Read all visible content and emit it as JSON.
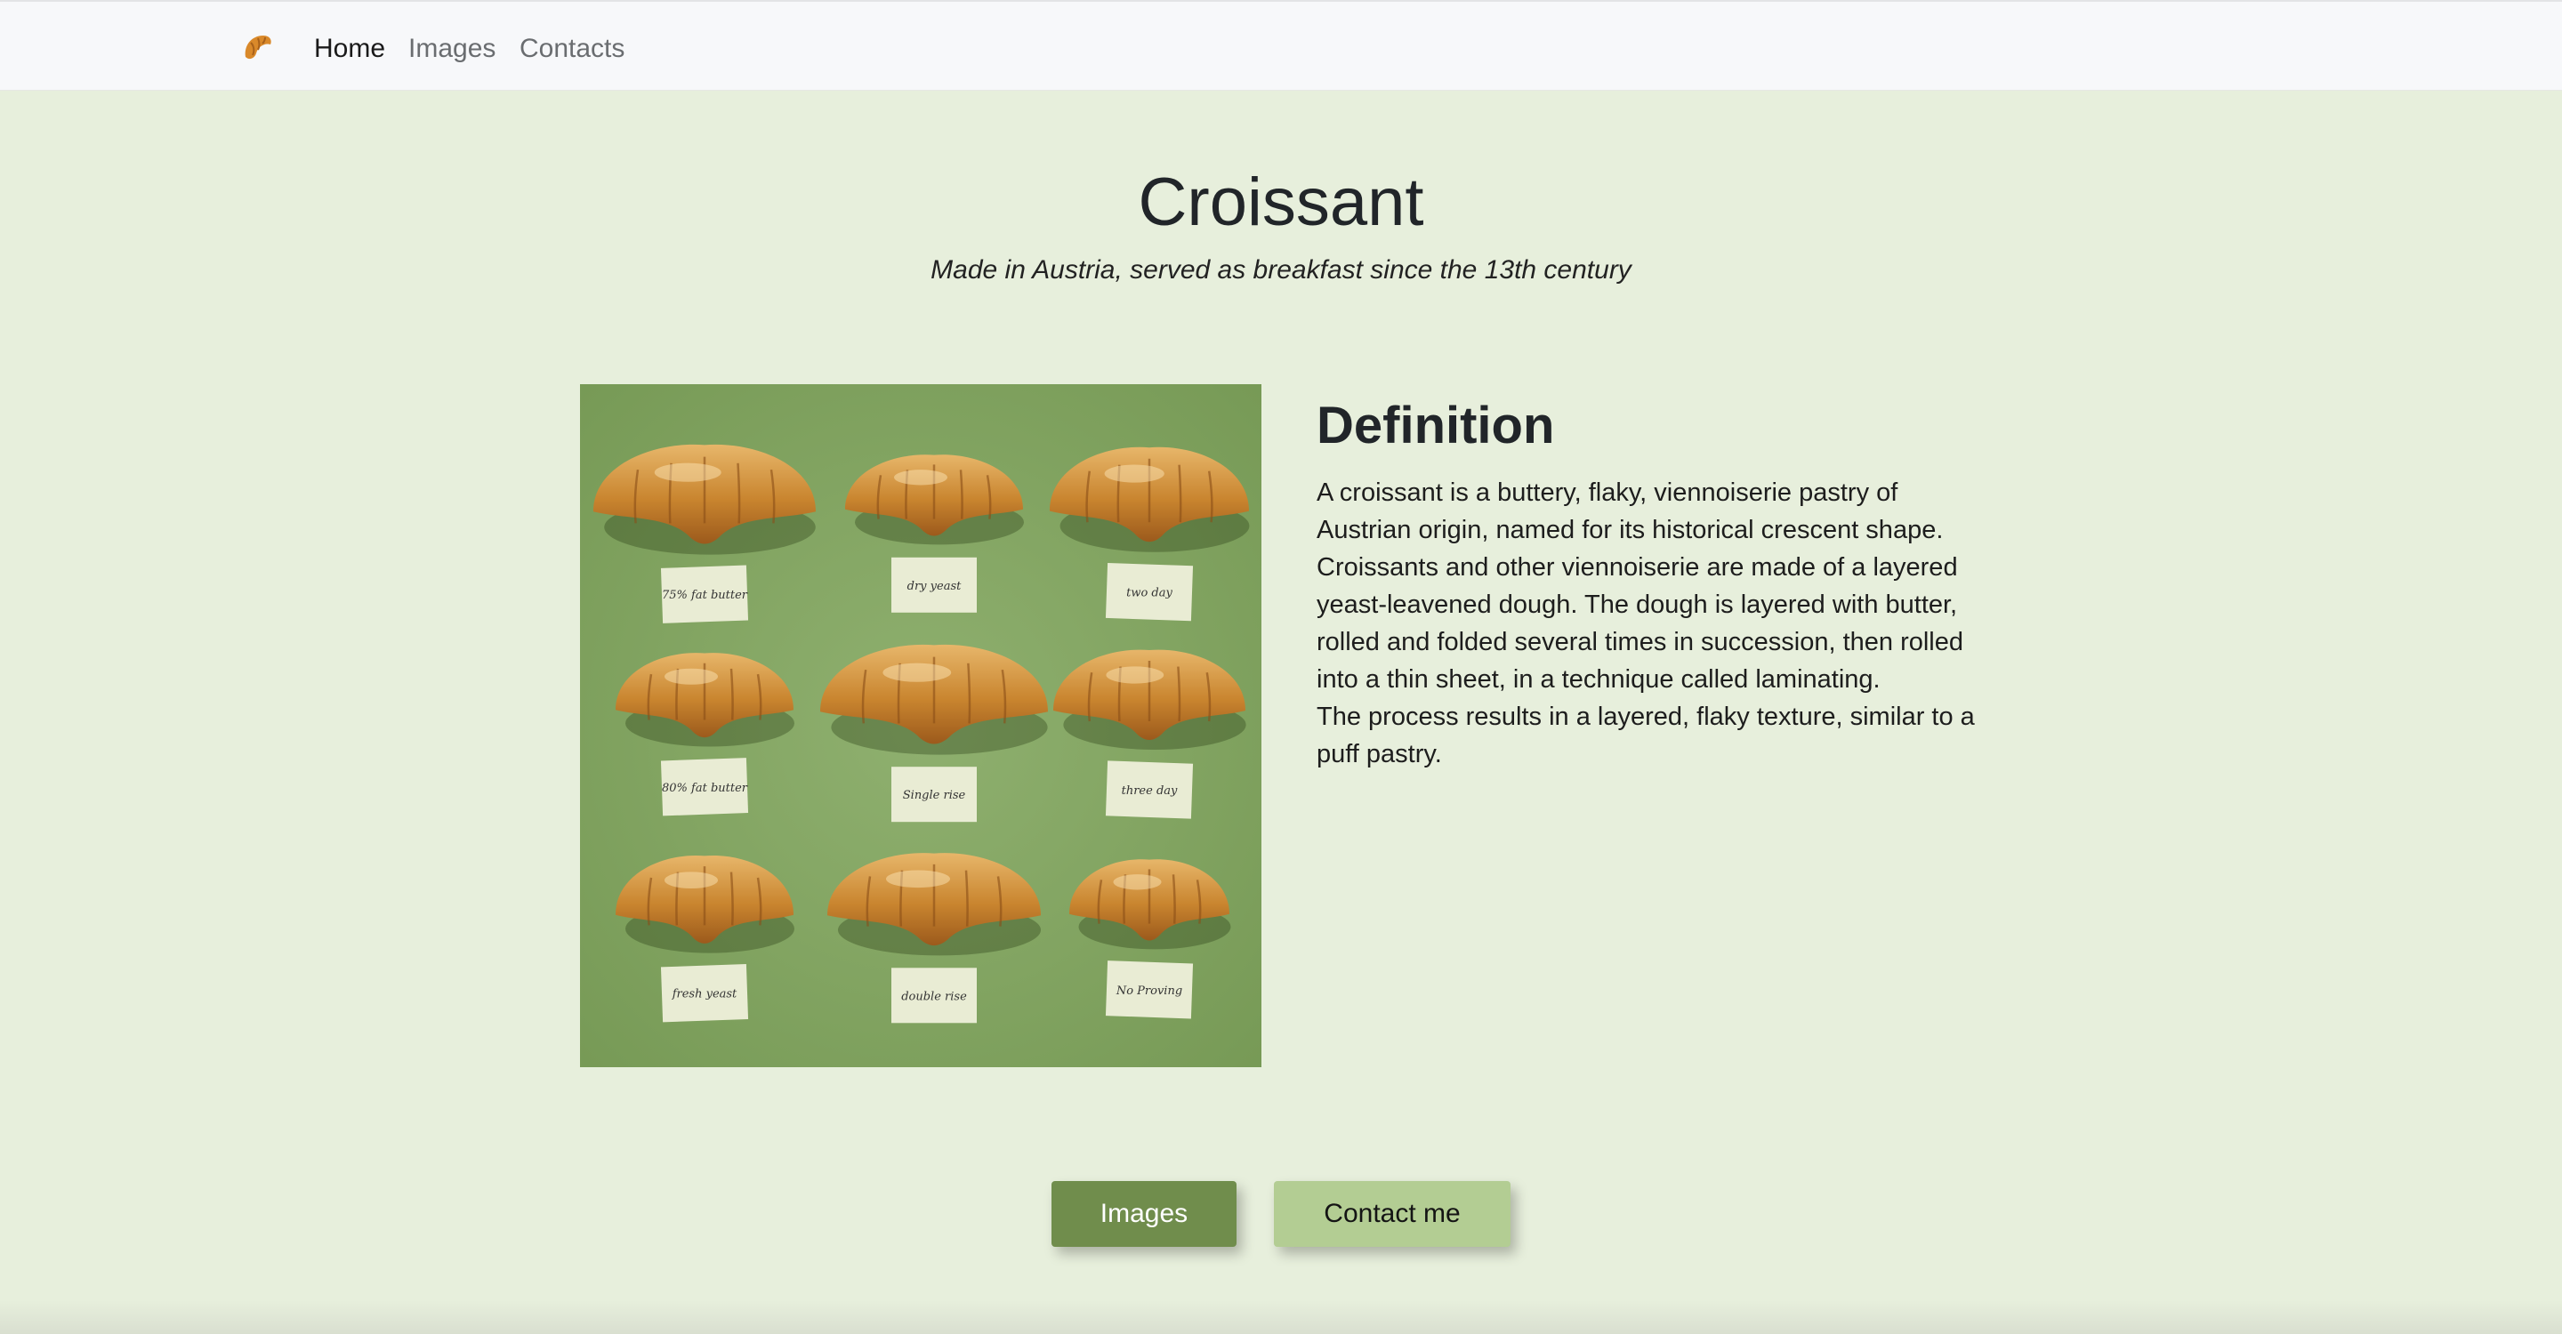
{
  "navbar": {
    "brand_icon": "croissant-icon",
    "links": [
      {
        "label": "Home",
        "active": true
      },
      {
        "label": "Images",
        "active": false
      },
      {
        "label": "Contacts",
        "active": false
      }
    ]
  },
  "hero": {
    "title": "Croissant",
    "subtitle": "Made in Austria, served as breakfast since the 13th century"
  },
  "photo": {
    "labels": [
      "75% fat butter",
      "dry yeast",
      "two day",
      "80% fat butter",
      "Single rise",
      "three day",
      "fresh yeast",
      "double rise",
      "No Proving"
    ]
  },
  "definition": {
    "title": "Definition",
    "paragraph1": "A croissant is a buttery, flaky, viennoiserie pastry of Austrian origin, named for its historical crescent shape. Croissants and other viennoiserie are made of a layered yeast-leavened dough. The dough is layered with butter, rolled and folded several times in succession, then rolled into a thin sheet, in a technique called laminating.",
    "paragraph2": "The process results in a layered, flaky texture, similar to a puff pastry."
  },
  "buttons": {
    "images": "Images",
    "contact": "Contact me"
  },
  "colors": {
    "background": "#e7efdc",
    "primary_button": "#708d4c",
    "secondary_button": "#b3cd93",
    "photo_background": "#86a865"
  }
}
